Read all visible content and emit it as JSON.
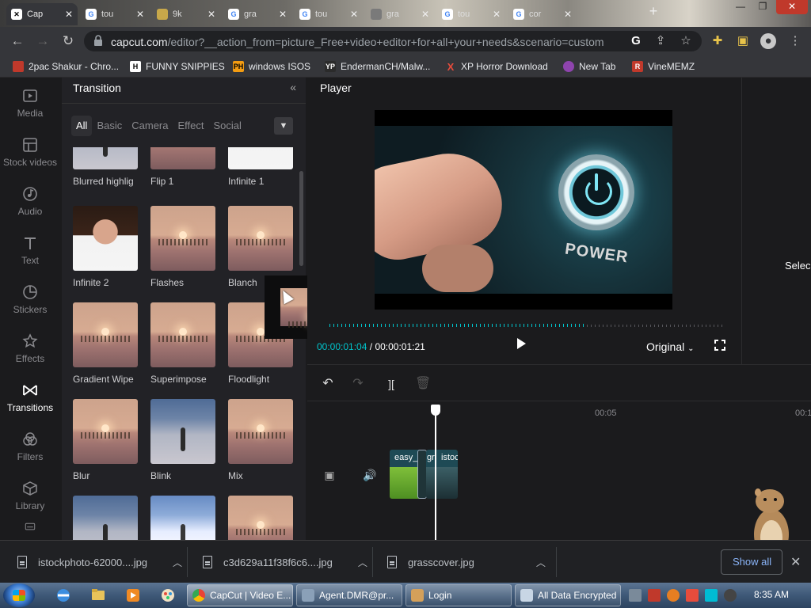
{
  "browser": {
    "tabs": [
      {
        "label": "Cap",
        "icon": "capcut-icon",
        "active": true
      },
      {
        "label": "tou",
        "icon": "google-icon",
        "active": false
      },
      {
        "label": "9k",
        "icon": "tab-icon",
        "active": false
      },
      {
        "label": "gra",
        "icon": "google-icon",
        "active": false
      },
      {
        "label": "tou",
        "icon": "google-icon",
        "active": false
      },
      {
        "label": "gra",
        "icon": "tab-icon",
        "active": false
      },
      {
        "label": "tou",
        "icon": "google-icon",
        "active": false
      },
      {
        "label": "cor",
        "icon": "google-icon",
        "active": false
      }
    ],
    "url_host": "capcut.com",
    "url_path": "/editor?__action_from=picture_Free+video+editor+for+all+your+needs&scenario=custom",
    "bookmarks": [
      {
        "label": "2pac Shakur - Chro...",
        "icon": "bookmark-icon",
        "color": "#c0392b"
      },
      {
        "label": "FUNNY SNIPPIES",
        "icon": "h-icon",
        "color": "#333333"
      },
      {
        "label": "windows ISOS",
        "icon": "ph-icon",
        "color": "#f39c12"
      },
      {
        "label": "EndermanCH/Malw...",
        "icon": "yp-icon",
        "color": "#2b2b2b"
      },
      {
        "label": "XP Horror Download",
        "icon": "x-icon",
        "color": "#e74c3c"
      },
      {
        "label": "New Tab",
        "icon": "globe-icon",
        "color": "#8e44ad"
      },
      {
        "label": "VineMEMZ",
        "icon": "r-icon",
        "color": "#c0392b"
      }
    ]
  },
  "rail": [
    {
      "label": "Media",
      "icon": "media-icon",
      "active": false
    },
    {
      "label": "Stock videos",
      "icon": "stock-videos-icon",
      "active": false
    },
    {
      "label": "Audio",
      "icon": "audio-icon",
      "active": false
    },
    {
      "label": "Text",
      "icon": "text-icon",
      "active": false
    },
    {
      "label": "Stickers",
      "icon": "stickers-icon",
      "active": false
    },
    {
      "label": "Effects",
      "icon": "effects-icon",
      "active": false
    },
    {
      "label": "Transitions",
      "icon": "transitions-icon",
      "active": true
    },
    {
      "label": "Filters",
      "icon": "filters-icon",
      "active": false
    },
    {
      "label": "Library",
      "icon": "library-icon",
      "active": false
    }
  ],
  "transition_panel": {
    "title": "Transition",
    "categories": [
      "All",
      "Basic",
      "Camera",
      "Effect",
      "Social"
    ],
    "active_category": "All",
    "tiles": [
      {
        "label": "Blurred highlig",
        "thumb": "lake"
      },
      {
        "label": "Flip 1",
        "thumb": "sunset"
      },
      {
        "label": "Infinite 1",
        "thumb": "woman"
      },
      {
        "label": "Infinite 2",
        "thumb": "woman"
      },
      {
        "label": "Flashes",
        "thumb": "sunset"
      },
      {
        "label": "Blanch",
        "thumb": "sunset"
      },
      {
        "label": "Gradient Wipe",
        "thumb": "sunset"
      },
      {
        "label": "Superimpose",
        "thumb": "sunset"
      },
      {
        "label": "Floodlight",
        "thumb": "sunset"
      },
      {
        "label": "Blur",
        "thumb": "sunset"
      },
      {
        "label": "Blink",
        "thumb": "lake"
      },
      {
        "label": "Mix",
        "thumb": "sunset"
      },
      {
        "label": "",
        "thumb": "lake"
      },
      {
        "label": "",
        "thumb": "lake"
      },
      {
        "label": "",
        "thumb": "sunset"
      }
    ]
  },
  "player": {
    "title": "Player",
    "video_text": "POWER",
    "current_time": "00:00:01:04",
    "separator": "/",
    "total_time": "00:00:01:21",
    "ratio_label": "Original",
    "progress": 0.65
  },
  "right_panel": {
    "label": "Selec"
  },
  "timeline": {
    "ruler": [
      "00:05",
      "00:1"
    ],
    "clips": [
      {
        "label": "easy_",
        "color": "#5aa32a"
      },
      {
        "label": "gr",
        "color": "#2c6a2a"
      },
      {
        "label": "istoc",
        "color": "#1e4a55"
      }
    ]
  },
  "downloads": {
    "items": [
      {
        "name": "istockphoto-62000....jpg"
      },
      {
        "name": "c3d629a11f38f6c6....jpg"
      },
      {
        "name": "grasscover.jpg"
      }
    ],
    "show_all": "Show all"
  },
  "taskbar": {
    "tasks": [
      {
        "label": "CapCut | Video E...",
        "icon": "chrome-icon",
        "color": "#4285f4"
      },
      {
        "label": "Agent.DMR@pr...",
        "icon": "window-icon",
        "color": "#8aa0b8"
      },
      {
        "label": "Login",
        "icon": "login-icon",
        "color": "#d4a05a"
      },
      {
        "label": "All Data Encrypted",
        "icon": "window-icon",
        "color": "#c8d6e5"
      }
    ],
    "clock": "8:35 AM"
  }
}
